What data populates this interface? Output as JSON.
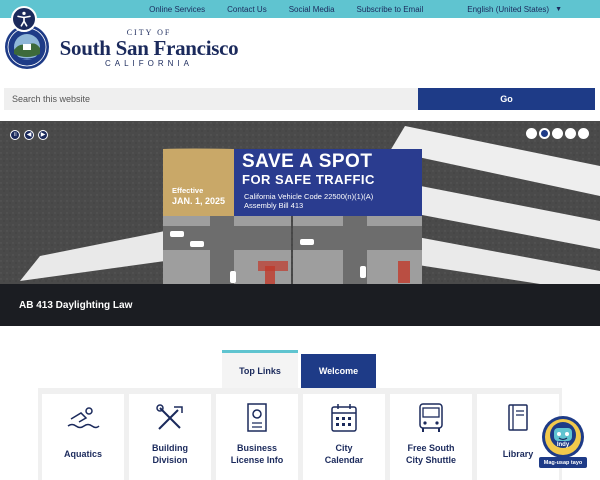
{
  "top_nav": {
    "items": [
      "Online Services",
      "Contact Us",
      "Social Media",
      "Subscribe to Email"
    ],
    "language": "English (United States)"
  },
  "header": {
    "city_prefix": "CITY OF",
    "city_name": "South San Francisco",
    "state": "CALIFORNIA"
  },
  "search": {
    "placeholder": "Search this website",
    "button_label": "Go"
  },
  "hero": {
    "caption": "AB 413 Daylighting Law",
    "sign_title_1": "SAVE A SPOT",
    "sign_title_2": "FOR SAFE TRAFFIC",
    "sign_line_1": "California Vehicle Code 22500(n)(1)(A)",
    "sign_line_2": "Assembly Bill 413",
    "effective_label": "Effective",
    "effective_date": "JAN. 1, 2025",
    "slide_count": 5,
    "active_slide": 2
  },
  "tabs": [
    {
      "label": "Top Links",
      "active": true
    },
    {
      "label": "Welcome",
      "active": false
    }
  ],
  "tiles": [
    {
      "label_1": "Aquatics",
      "label_2": "",
      "icon": "swimmer-icon"
    },
    {
      "label_1": "Building",
      "label_2": "Division",
      "icon": "tools-icon"
    },
    {
      "label_1": "Business",
      "label_2": "License Info",
      "icon": "certificate-icon"
    },
    {
      "label_1": "City",
      "label_2": "Calendar",
      "icon": "calendar-icon"
    },
    {
      "label_1": "Free South",
      "label_2": "City Shuttle",
      "icon": "bus-icon"
    },
    {
      "label_1": "Library",
      "label_2": "",
      "icon": "book-icon"
    }
  ],
  "indy": {
    "name": "Indy",
    "tagline": "Mag-usap tayo"
  },
  "colors": {
    "topbar": "#5fc4d0",
    "navy": "#1b2a5c",
    "button_blue": "#1e3b87",
    "sign_blue": "#2a3c8f",
    "sign_gold": "#c9a868"
  }
}
